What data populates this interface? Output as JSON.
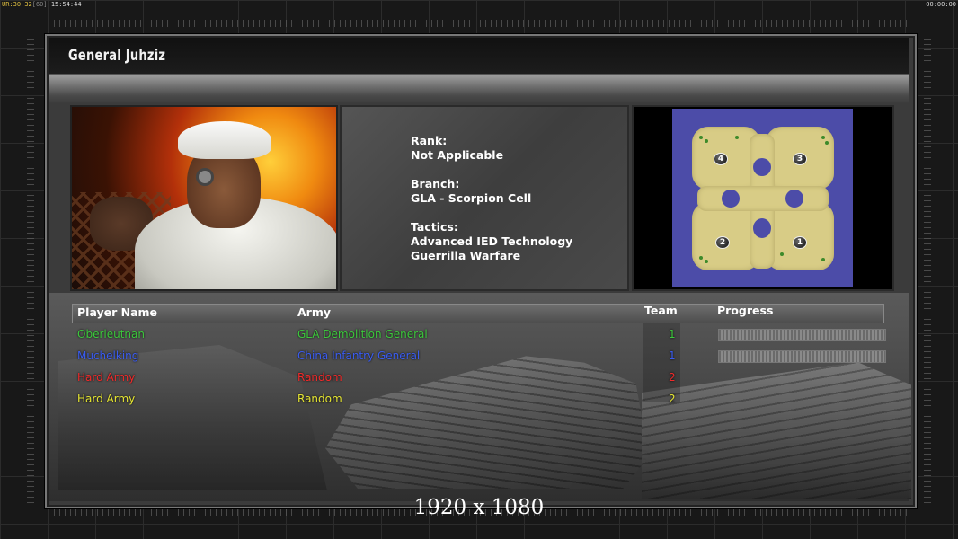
{
  "status_bar": {
    "left_prefix": "UR:",
    "left_fps": "30",
    "left_target": "32",
    "left_detail": "[60]",
    "left_time": "15:54:44",
    "right_time": "00:00:00"
  },
  "general": {
    "title": "General Juhziz",
    "rank_label": "Rank:",
    "rank_value": "Not Applicable",
    "branch_label": "Branch:",
    "branch_value": "GLA - Scorpion Cell",
    "tactics_label": "Tactics:",
    "tactics": [
      "Advanced IED Technology",
      "Guerrilla Warfare"
    ]
  },
  "map": {
    "spots": [
      "4",
      "3",
      "2",
      "1"
    ]
  },
  "players_table": {
    "headers": {
      "player": "Player Name",
      "army": "Army",
      "team": "Team",
      "progress": "Progress"
    },
    "rows": [
      {
        "name": "Oberleutnan",
        "army": "GLA Demolition General",
        "team": "1",
        "color": "#3cc83c",
        "progress": 1.0
      },
      {
        "name": "Muchelking",
        "army": "China Infantry General",
        "team": "1",
        "color": "#3a5cf0",
        "progress": 1.0
      },
      {
        "name": "Hard Army",
        "army": "Random",
        "team": "2",
        "color": "#f02a2a",
        "progress": null
      },
      {
        "name": "Hard Army",
        "army": "Random",
        "team": "2",
        "color": "#e6e632",
        "progress": null
      }
    ]
  },
  "resolution_label": "1920 x 1080"
}
